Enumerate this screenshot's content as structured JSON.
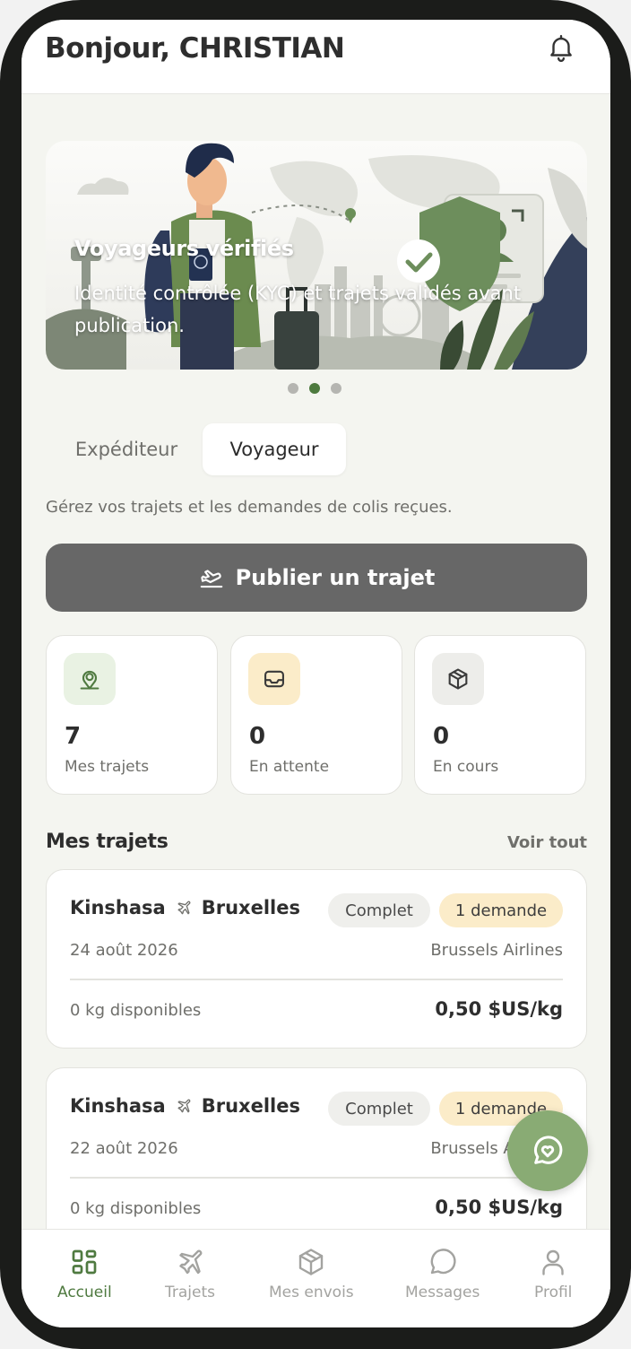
{
  "header": {
    "greeting": "Bonjour, CHRISTIAN",
    "bell_icon": "bell-icon"
  },
  "carousel": {
    "title": "Voyageurs vérifiés",
    "subtitle": "Identité contrôlée (KYC) et trajets validés avant publication.",
    "dots": 3,
    "active_dot": 2
  },
  "role_tabs": {
    "sender": "Expéditeur",
    "traveler": "Voyageur",
    "selected": "Voyageur"
  },
  "description": "Gérez vos trajets et les demandes de colis reçues.",
  "publish_button": {
    "label": "Publier un trajet",
    "icon": "plane-takeoff-icon"
  },
  "stats": [
    {
      "value": "7",
      "label": "Mes trajets",
      "icon": "map-pin-icon"
    },
    {
      "value": "0",
      "label": "En attente",
      "icon": "inbox-icon"
    },
    {
      "value": "0",
      "label": "En cours",
      "icon": "package-icon"
    }
  ],
  "section": {
    "title": "Mes trajets",
    "link": "Voir tout"
  },
  "trips": [
    {
      "from": "Kinshasa",
      "to": "Bruxelles",
      "status": "Complet",
      "requests": "1 demande",
      "date": "24 août 2026",
      "airline": "Brussels Airlines",
      "capacity": "0 kg disponibles",
      "price": "0,50 $US/kg"
    },
    {
      "from": "Kinshasa",
      "to": "Bruxelles",
      "status": "Complet",
      "requests": "1 demande",
      "date": "22 août 2026",
      "airline": "Brussels Airlines",
      "capacity": "0 kg disponibles",
      "price": "0,50 $US/kg"
    }
  ],
  "fab": {
    "icon": "chat-heart-icon"
  },
  "nav": [
    {
      "label": "Accueil",
      "icon": "dashboard-icon",
      "active": true
    },
    {
      "label": "Trajets",
      "icon": "plane-icon"
    },
    {
      "label": "Mes envois",
      "icon": "package-icon"
    },
    {
      "label": "Messages",
      "icon": "message-icon"
    },
    {
      "label": "Profil",
      "icon": "user-icon"
    }
  ],
  "colors": {
    "accent": "#4f7a40",
    "fab": "#89ab74",
    "publish": "#676767",
    "request_badge": "#fbecc9"
  }
}
